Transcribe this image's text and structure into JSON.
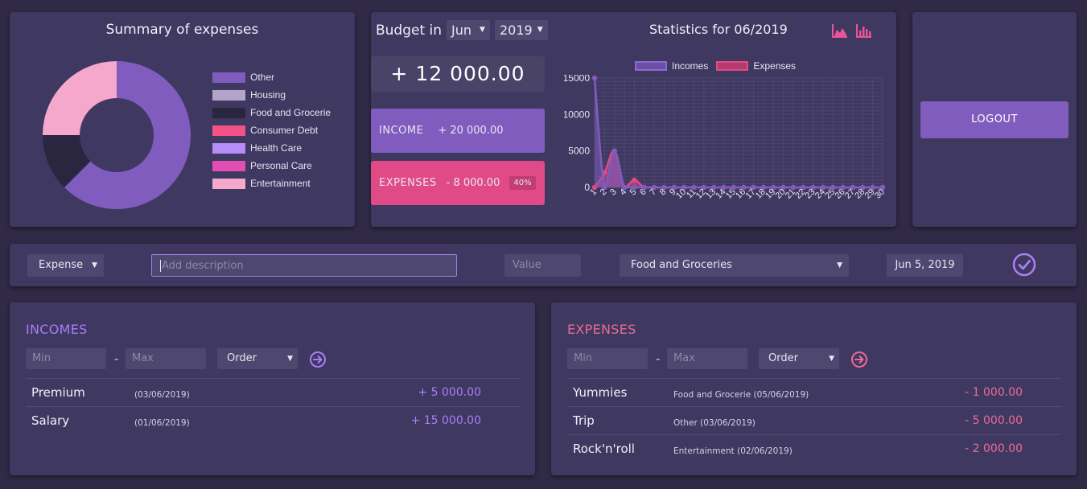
{
  "summary": {
    "title": "Summary of expenses",
    "legend": [
      {
        "label": "Other",
        "color": "#7f5cbd"
      },
      {
        "label": "Housing",
        "color": "#b3a5c9"
      },
      {
        "label": "Food and Grocerie",
        "color": "#2b2640"
      },
      {
        "label": "Consumer Debt",
        "color": "#f25285"
      },
      {
        "label": "Health Care",
        "color": "#b68cf7"
      },
      {
        "label": "Personal Care",
        "color": "#e24eb4"
      },
      {
        "label": "Entertainment",
        "color": "#f5a8cb"
      }
    ],
    "donut_values": [
      {
        "label": "Other",
        "value": 5000
      },
      {
        "label": "Food and Grocerie",
        "value": 1000
      },
      {
        "label": "Entertainment",
        "value": 2000
      }
    ]
  },
  "budget": {
    "label": "Budget in",
    "month": "Jun",
    "year": "2019",
    "total": "+ 12 000.00",
    "income_label": "INCOME",
    "income_value": "+ 20 000.00",
    "expenses_label": "EXPENSES",
    "expenses_value": "- 8 000.00",
    "expenses_pct": "40%"
  },
  "stats": {
    "title": "Statistics for 06/2019",
    "icons": [
      "area-chart-icon",
      "bar-chart-icon"
    ]
  },
  "chart_data": {
    "type": "area",
    "x": [
      "1",
      "2",
      "3",
      "4",
      "5",
      "6",
      "7",
      "8",
      "9",
      "10",
      "11",
      "12",
      "13",
      "14",
      "15",
      "16",
      "17",
      "18",
      "19",
      "20",
      "21",
      "22",
      "23",
      "24",
      "25",
      "26",
      "27",
      "28",
      "29",
      "30"
    ],
    "series": [
      {
        "name": "Incomes",
        "color": "#7f5cbd",
        "values": [
          15000,
          0,
          5000,
          0,
          0,
          0,
          0,
          0,
          0,
          0,
          0,
          0,
          0,
          0,
          0,
          0,
          0,
          0,
          0,
          0,
          0,
          0,
          0,
          0,
          0,
          0,
          0,
          0,
          0,
          0
        ]
      },
      {
        "name": "Expenses",
        "color": "#e04a86",
        "values": [
          0,
          2000,
          5000,
          0,
          1000,
          0,
          0,
          0,
          0,
          0,
          0,
          0,
          0,
          0,
          0,
          0,
          0,
          0,
          0,
          0,
          0,
          0,
          0,
          0,
          0,
          0,
          0,
          0,
          0,
          0
        ]
      }
    ],
    "yticks": [
      "0",
      "5000",
      "10000",
      "15000"
    ],
    "ylim": [
      0,
      15000
    ],
    "grid": true,
    "legend_position": "top"
  },
  "logout": {
    "label": "LOGOUT"
  },
  "form": {
    "type": "Expense",
    "description_placeholder": "Add description",
    "value_placeholder": "Value",
    "category": "Food and Groceries",
    "date": "Jun 5, 2019"
  },
  "incomes": {
    "title": "INCOMES",
    "min_placeholder": "Min",
    "max_placeholder": "Max",
    "dash": "-",
    "order": "Order",
    "rows": [
      {
        "name": "Premium",
        "meta": "(03/06/2019)",
        "amount": "+ 5 000.00"
      },
      {
        "name": "Salary",
        "meta": "(01/06/2019)",
        "amount": "+ 15 000.00"
      }
    ]
  },
  "expenses": {
    "title": "EXPENSES",
    "min_placeholder": "Min",
    "max_placeholder": "Max",
    "dash": "-",
    "order": "Order",
    "rows": [
      {
        "name": "Yummies",
        "meta": "Food and Grocerie (05/06/2019)",
        "amount": "- 1 000.00"
      },
      {
        "name": "Trip",
        "meta": "Other (03/06/2019)",
        "amount": "- 5 000.00"
      },
      {
        "name": "Rock'n'roll",
        "meta": "Entertainment (02/06/2019)",
        "amount": "- 2 000.00"
      }
    ]
  }
}
